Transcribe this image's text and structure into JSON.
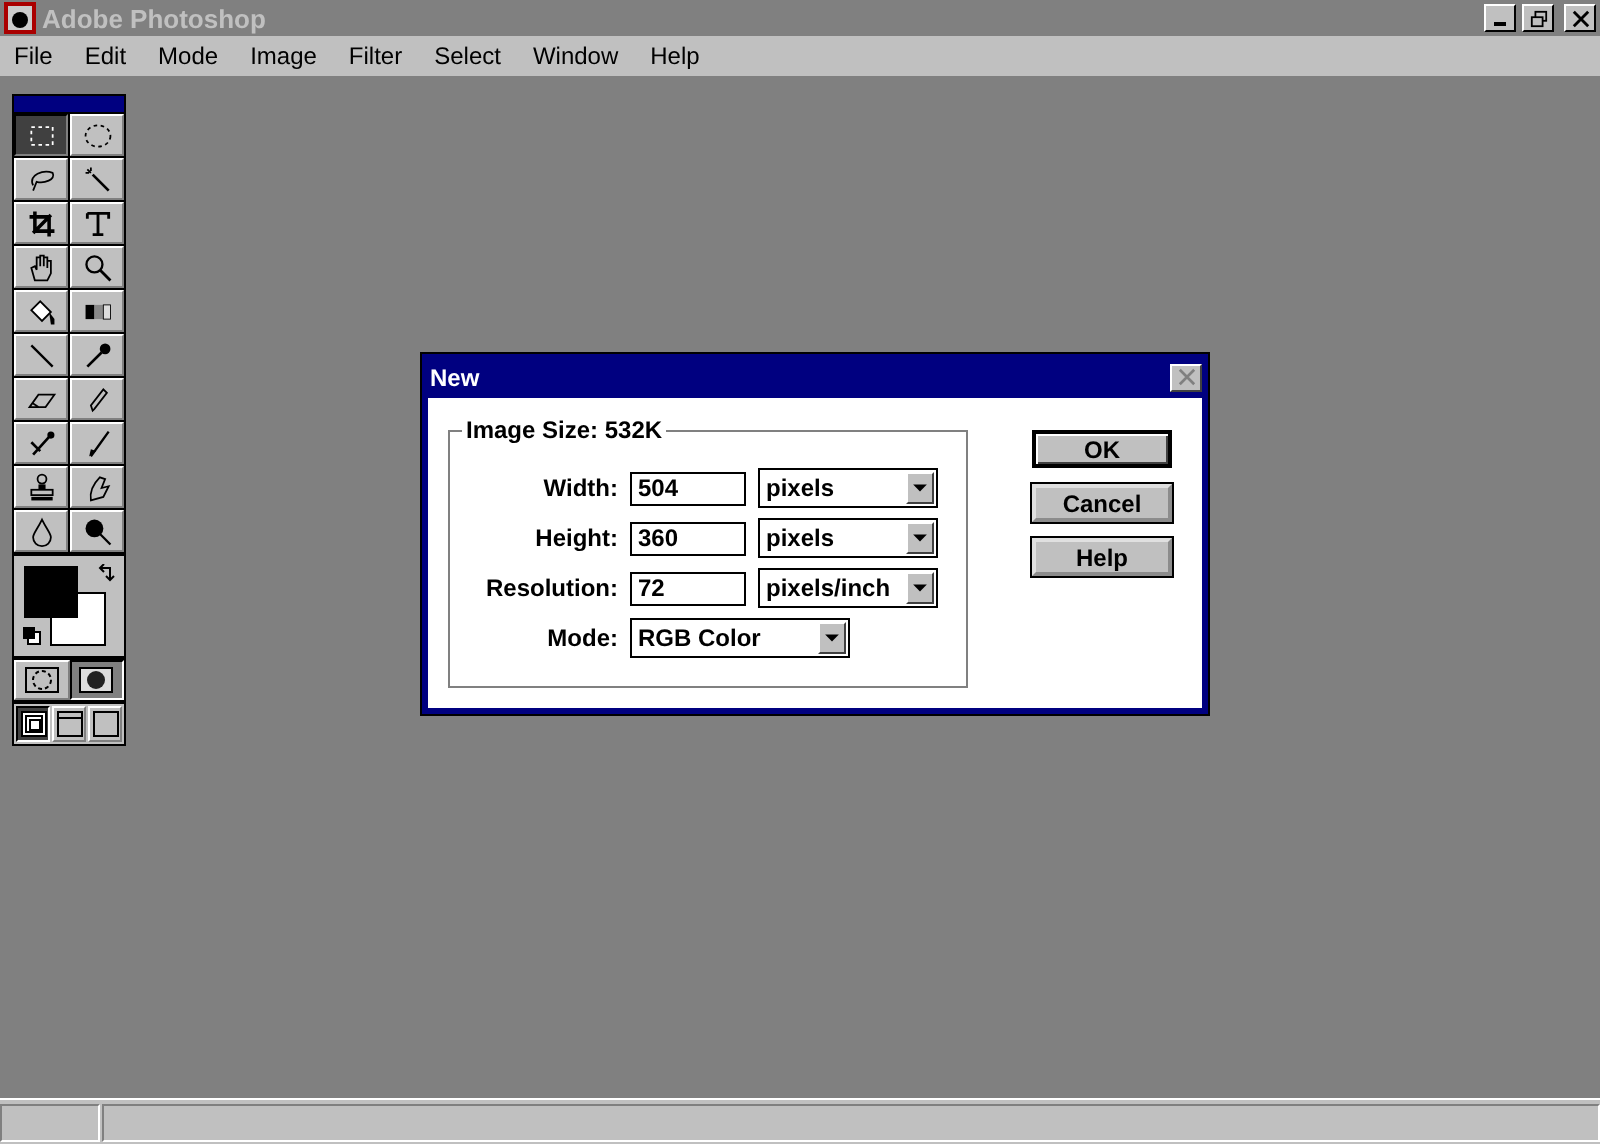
{
  "window": {
    "title": "Adobe Photoshop"
  },
  "menu": [
    {
      "label": "File"
    },
    {
      "label": "Edit"
    },
    {
      "label": "Mode"
    },
    {
      "label": "Image"
    },
    {
      "label": "Filter"
    },
    {
      "label": "Select"
    },
    {
      "label": "Window"
    },
    {
      "label": "Help"
    }
  ],
  "toolbox": {
    "tools": [
      {
        "selected": true
      },
      {
        "selected": false
      },
      {
        "selected": false
      },
      {
        "selected": false
      },
      {
        "selected": false
      },
      {
        "selected": false
      },
      {
        "selected": false
      },
      {
        "selected": false
      },
      {
        "selected": false
      },
      {
        "selected": false
      },
      {
        "selected": false
      },
      {
        "selected": false
      },
      {
        "selected": false
      },
      {
        "selected": false
      },
      {
        "selected": false
      },
      {
        "selected": false
      },
      {
        "selected": false
      },
      {
        "selected": false
      },
      {
        "selected": false
      },
      {
        "selected": false
      }
    ],
    "mask_modes": [
      {
        "selected": false
      },
      {
        "selected": true
      }
    ],
    "screen_modes": [
      {
        "selected": true
      },
      {
        "selected": false
      },
      {
        "selected": false
      }
    ]
  },
  "dialog": {
    "title": "New",
    "group_label": "Image Size: 532K",
    "fields": [
      {
        "label": "Width:",
        "value": "504",
        "unit": "pixels"
      },
      {
        "label": "Height:",
        "value": "360",
        "unit": "pixels"
      },
      {
        "label": "Resolution:",
        "value": "72",
        "unit": "pixels/inch"
      }
    ],
    "mode": {
      "label": "Mode:",
      "value": "RGB Color"
    },
    "buttons": [
      {
        "label": "OK",
        "default": true
      },
      {
        "label": "Cancel",
        "default": false
      },
      {
        "label": "Help",
        "default": false
      }
    ]
  }
}
